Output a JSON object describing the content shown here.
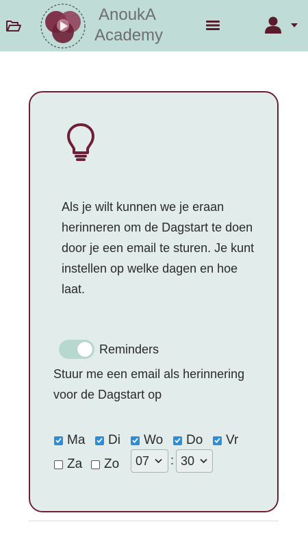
{
  "header": {
    "brand_line1": "AnoukA",
    "brand_line2": "Academy",
    "icons": {
      "folder": "folder-open-icon",
      "logo": "anouka-logo",
      "menu": "hamburger-menu-icon",
      "user": "user-icon",
      "dropdown": "caret-down-icon"
    },
    "background_color": "#bfdcd6"
  },
  "card": {
    "icon": "lightbulb-icon",
    "intro_text": "Als je wilt kunnen we je eraan herinneren om de Dagstart te doen door je een email te sturen. Je kunt instellen op welke dagen en hoe laat.",
    "reminders_label": "Reminders",
    "reminders_enabled": true,
    "email_description": "Stuur me een email als herinnering voor de Dagstart op",
    "days": [
      {
        "label": "Ma",
        "checked": true
      },
      {
        "label": "Di",
        "checked": true
      },
      {
        "label": "Wo",
        "checked": true
      },
      {
        "label": "Do",
        "checked": true
      },
      {
        "label": "Vr",
        "checked": true
      },
      {
        "label": "Za",
        "checked": false
      },
      {
        "label": "Zo",
        "checked": false
      }
    ],
    "time": {
      "hour": "07",
      "separator": ":",
      "minute": "30"
    },
    "border_color": "#6d2035",
    "background_color": "#e2ecea"
  },
  "colors": {
    "accent": "#6d2035",
    "checkbox": "#2b8ed6",
    "toggle": "#b6d8cf"
  }
}
